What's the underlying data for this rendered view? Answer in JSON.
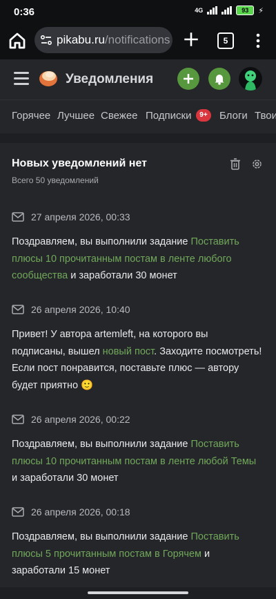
{
  "status_bar": {
    "time": "0:36",
    "network": "4G",
    "battery": "93"
  },
  "browser": {
    "url_domain": "pikabu.ru",
    "url_path": "/notifications",
    "tab_count": "5"
  },
  "header": {
    "title": "Уведомления"
  },
  "nav": {
    "items": [
      "Горячее",
      "Лучшее",
      "Свежее",
      "Подписки",
      "Блоги",
      "Твои"
    ],
    "subscriptions_badge": "9+"
  },
  "notifications_panel": {
    "title": "Новых уведомлений нет",
    "subtitle": "Всего 50 уведомлений",
    "items": [
      {
        "date": "27 апреля 2026, 00:33",
        "text_before": "Поздравляем, вы выполнили задание ",
        "link": "Поставить плюсы 10 прочитанным постам в ленте любого сообщества",
        "text_after": " и заработали 30 монет"
      },
      {
        "date": "26 апреля 2026, 10:40",
        "text_before": "Привет! У автора artemleft, на которого вы подписаны, вышел ",
        "link": "новый пост",
        "text_after": ". Заходите посмотреть! Если пост понравится, поставьте плюс — автору будет приятно 🙂"
      },
      {
        "date": "26 апреля 2026, 00:22",
        "text_before": "Поздравляем, вы выполнили задание ",
        "link": "Поставить плюсы 10 прочитанным постам в ленте любой Темы",
        "text_after": " и заработали 30 монет"
      },
      {
        "date": "26 апреля 2026, 00:18",
        "text_before": "Поздравляем, вы выполнили задание ",
        "link": "Поставить плюсы 5 прочитанным постам в Горячем",
        "text_after": " и заработали 15 монет"
      }
    ]
  },
  "colors": {
    "accent": "#57973d",
    "link": "#71a85a",
    "badge": "#d9363e"
  }
}
